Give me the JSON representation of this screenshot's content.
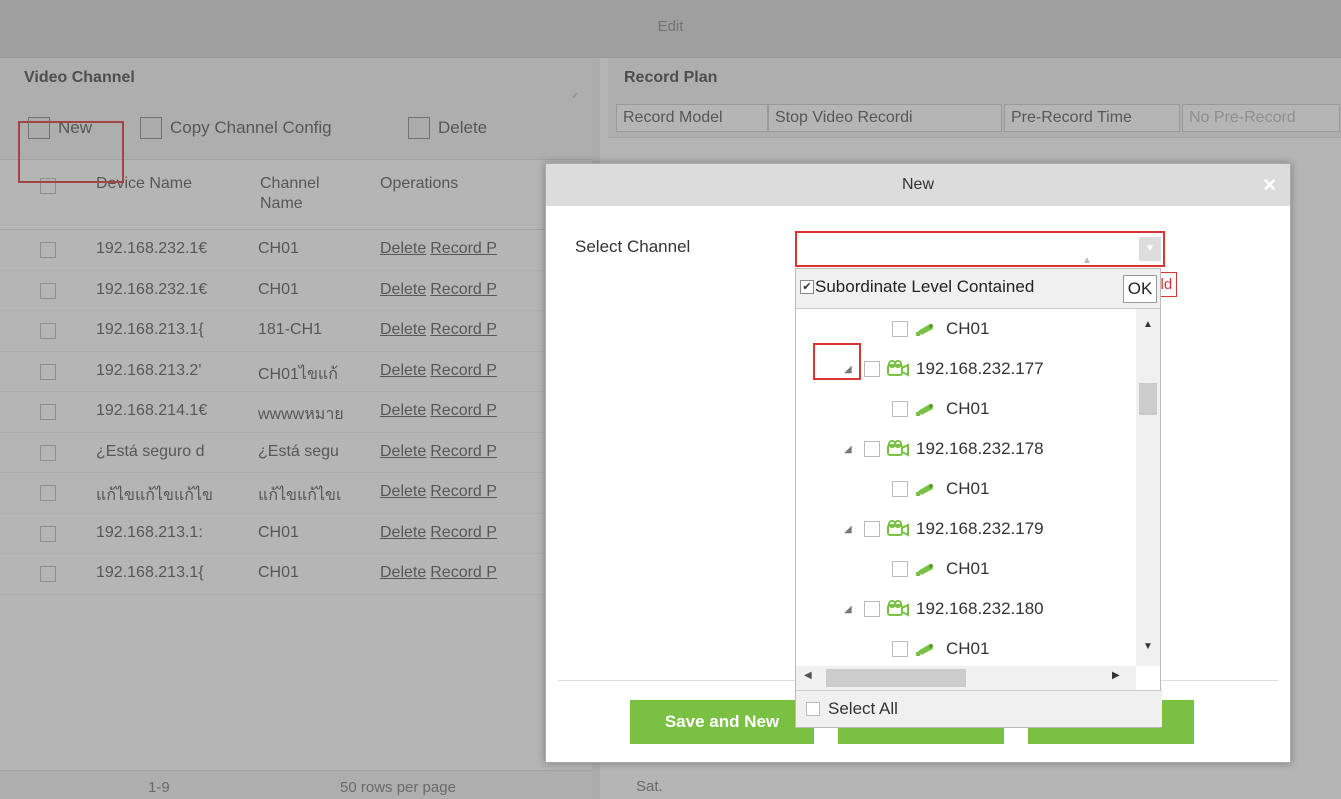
{
  "topbar": {
    "title": "Edit"
  },
  "video_channel": {
    "title": "Video Channel",
    "toolbar": {
      "new": "New",
      "copy": "Copy Channel Config",
      "delete": "Delete"
    },
    "columns": [
      "Device Name",
      "Channel Name",
      "Operations"
    ],
    "rows": [
      {
        "device": "192.168.232.1€",
        "channel": "CH01"
      },
      {
        "device": "192.168.232.1€",
        "channel": "CH01"
      },
      {
        "device": "192.168.213.1{",
        "channel": "181-CH1"
      },
      {
        "device": "192.168.213.2'",
        "channel": "CH01ไขแก้"
      },
      {
        "device": "192.168.214.1€",
        "channel": "wwwwหมาย"
      },
      {
        "device": "¿Está seguro d",
        "channel": "¿Está segu"
      },
      {
        "device": "แก้ไขแก้ไขแก้ไข",
        "channel": "แก้ไขแก้ไขเ"
      },
      {
        "device": "192.168.213.1:",
        "channel": "CH01"
      },
      {
        "device": "192.168.213.1{",
        "channel": "CH01"
      }
    ],
    "op_delete": "Delete",
    "op_record": "Record P",
    "pager": {
      "range": "1-9",
      "per_page": "50 rows per page"
    }
  },
  "record_plan": {
    "title": "Record Plan",
    "record_model_label": "Record Model",
    "record_model_value": "Stop Video Recordi",
    "pre_record_label": "Pre-Record Time",
    "pre_record_value": "No Pre-Record",
    "day": "Sat."
  },
  "dialog": {
    "title": "New",
    "close": "×",
    "select_channel_label": "Select Channel",
    "required_hint": "y Field",
    "subordinate_label": "Subordinate Level Contained",
    "ok": "OK",
    "select_all": "Select All",
    "tree": [
      {
        "type": "channel",
        "label": "CH01"
      },
      {
        "type": "device",
        "label": "192.168.232.177"
      },
      {
        "type": "channel",
        "label": "CH01"
      },
      {
        "type": "device",
        "label": "192.168.232.178"
      },
      {
        "type": "channel",
        "label": "CH01"
      },
      {
        "type": "device",
        "label": "192.168.232.179"
      },
      {
        "type": "channel",
        "label": "CH01"
      },
      {
        "type": "device",
        "label": "192.168.232.180"
      },
      {
        "type": "channel",
        "label": "CH01"
      }
    ],
    "buttons": {
      "save_new": "Save and New",
      "ok": "",
      "cancel": ""
    }
  },
  "colors": {
    "accent": "#7ac143",
    "highlight": "#dd3333"
  },
  "icons": [
    "new-icon",
    "copy-icon",
    "delete-icon",
    "device-icon",
    "camera-icon",
    "close-icon"
  ]
}
